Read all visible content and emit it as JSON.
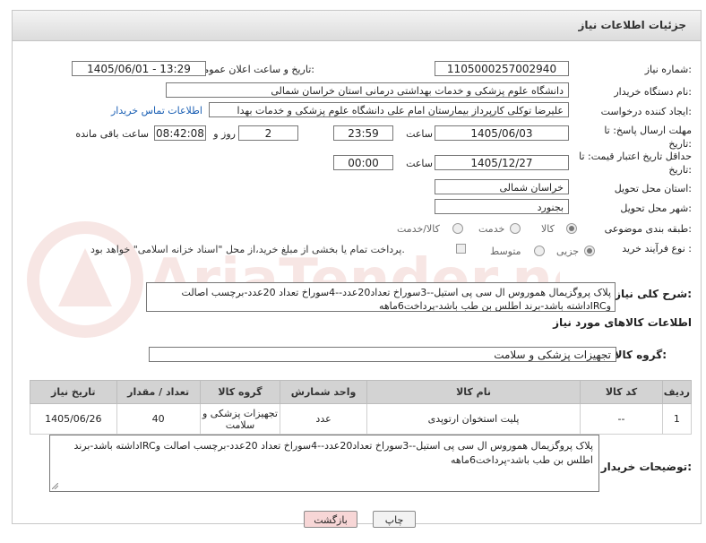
{
  "header": {
    "title": "جزئیات اطلاعات نیاز"
  },
  "fields": {
    "need_number_label": "شماره نیاز:",
    "need_number": "1105000257002940",
    "announce_label": "تاریخ و ساعت اعلان عمومی:",
    "announce_value": "1405/06/01 - 13:29",
    "buyer_label": "نام دستگاه خریدار:",
    "buyer_value": "دانشگاه علوم پزشکی و خدمات بهداشتی درمانی استان خراسان شمالی",
    "creator_label": "ایجاد کننده درخواست:",
    "creator_value": "علیرضا توکلی کارپرداز بیمارستان امام علی دانشگاه علوم پزشکی و خدمات بهدا",
    "contact_link": "اطلاعات تماس خریدار",
    "deadline_label": "مهلت ارسال پاسخ: تا تاریخ:",
    "deadline_date": "1405/06/03",
    "time_label": "ساعت",
    "deadline_time": "23:59",
    "days_count": "2",
    "days_label": "روز و",
    "remaining_time": "08:42:08",
    "remaining_label": "ساعت باقی مانده",
    "validity_label": "حداقل تاریخ اعتبار قیمت: تا تاریخ:",
    "validity_date": "1405/12/27",
    "validity_time_label": "ساعت",
    "validity_time": "00:00",
    "province_label": "استان محل تحویل:",
    "province_value": "خراسان شمالی",
    "city_label": "شهر محل تحویل:",
    "city_value": "بجنورد",
    "category_label": "طبقه بندی موضوعی:",
    "category_options": [
      "کالا",
      "خدمت",
      "کالا/خدمت"
    ],
    "category_selected": "کالا",
    "process_label": "نوع فرآیند خرید :",
    "process_options": [
      "جزیی",
      "متوسط"
    ],
    "process_selected": "جزیی",
    "payment_note": "پرداخت تمام یا بخشی از مبلغ خرید،از محل \"اسناد خزانه اسلامی\" خواهد بود."
  },
  "description": {
    "label": "شرح کلی نیاز:",
    "text": "پلاک پروگزیمال هموروس ال سی پی استیل--3سوراخ تعداد20عدد--4سوراخ تعداد 20عدد-برچسب اصالت وIRCداشته باشد-برند اطلس بن طب باشد-پرداخت6ماهه"
  },
  "goods_section": {
    "title": "اطلاعات کالاهای مورد نیاز",
    "group_label": "گروه کالا:",
    "group_value": "تجهیزات پزشکی و سلامت"
  },
  "table": {
    "headers": [
      "ردیف",
      "کد کالا",
      "نام کالا",
      "واحد شمارش",
      "گروه کالا",
      "تعداد / مقدار",
      "تاریخ نیاز"
    ],
    "rows": [
      [
        "1",
        "--",
        "پلیت استخوان ارتوپدی",
        "عدد",
        "تجهیزات پزشکی و سلامت",
        "40",
        "1405/06/26"
      ]
    ]
  },
  "buyer_notes": {
    "label": "توضیحات خریدار:",
    "text": "پلاک پروگزیمال هموروس ال سی پی استیل--3سوراخ تعداد20عدد--4سوراخ تعداد 20عدد-برچسب اصالت وIRCداشته باشد-برند اطلس بن طب باشد-پرداخت6ماهه"
  },
  "buttons": {
    "print": "چاپ",
    "back": "بازگشت"
  },
  "watermark": {
    "text": "AriaTender.net"
  },
  "colors": {
    "link": "#1a5fb4",
    "back_button_bg": "#f7d6d6",
    "header_bg": "#d3d3d3",
    "watermark": "#c0392b"
  }
}
